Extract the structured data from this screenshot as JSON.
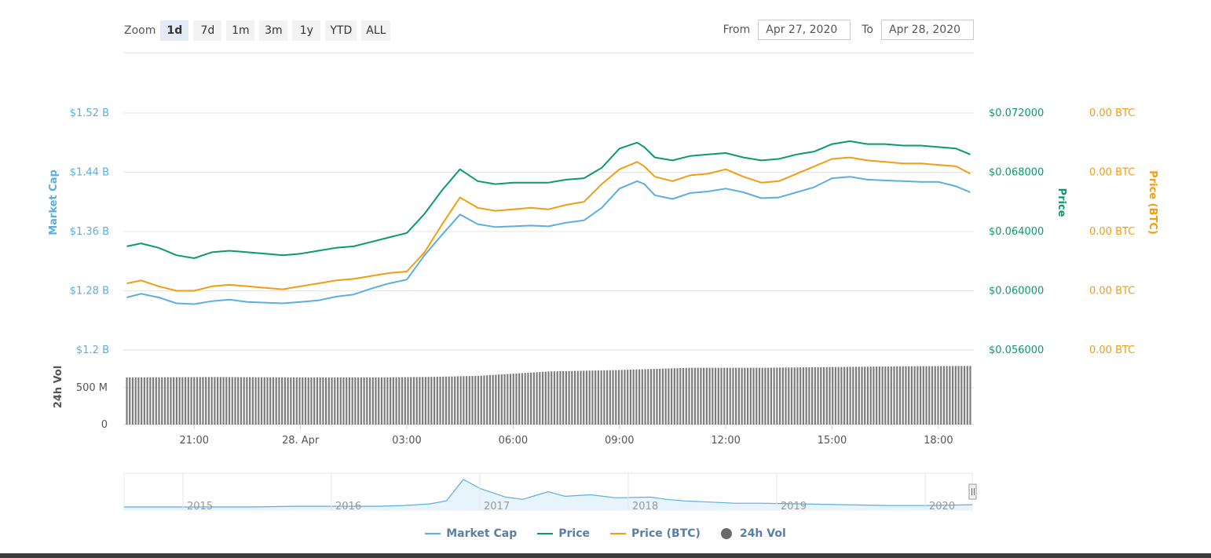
{
  "toolbar": {
    "zoom_label": "Zoom",
    "buttons": [
      "1d",
      "7d",
      "1m",
      "3m",
      "1y",
      "YTD",
      "ALL"
    ],
    "active": "1d",
    "from_label": "From",
    "from_value": "Apr 27, 2020",
    "to_label": "To",
    "to_value": "Apr 28, 2020"
  },
  "colors": {
    "market_cap": "#5aaee0",
    "price": "#0b9a6d",
    "price_btc": "#f39c12",
    "volume": "#7c7c7c",
    "market_cap_axis": "#5aaee0",
    "price_axis": "#0b9a6d",
    "price_btc_axis": "#f39c12"
  },
  "chart_data": {
    "type": "line",
    "x_ticks": [
      "21:00",
      "28. Apr",
      "03:00",
      "06:00",
      "09:00",
      "12:00",
      "15:00",
      "18:00"
    ],
    "x_tick_hours": [
      21,
      24,
      27,
      30,
      33,
      36,
      39,
      42
    ],
    "x_range_hours": [
      19.0,
      43.0
    ],
    "axes": {
      "market_cap": {
        "label": "Market Cap",
        "ticks": [
          "$1.52 B",
          "$1.44 B",
          "$1.36 B",
          "$1.28 B",
          "$1.2 B"
        ],
        "ylim": [
          1.2,
          1.52
        ]
      },
      "price": {
        "label": "Price",
        "ticks": [
          "$0.072000",
          "$0.068000",
          "$0.064000",
          "$0.060000",
          "$0.056000"
        ],
        "ylim": [
          0.056,
          0.072
        ]
      },
      "price_btc": {
        "label": "Price (BTC)",
        "ticks": [
          "0.00 BTC",
          "0.00 BTC",
          "0.00 BTC",
          "0.00 BTC",
          "0.00 BTC"
        ]
      },
      "volume": {
        "label": "24h Vol",
        "ticks": [
          "500 M",
          "0"
        ],
        "ylim": [
          0,
          1000
        ]
      }
    },
    "series": [
      {
        "name": "Market Cap",
        "key": "market_cap",
        "x": [
          19.1,
          19.5,
          20.0,
          20.5,
          21.0,
          21.5,
          22.0,
          22.5,
          23.0,
          23.5,
          24.0,
          24.5,
          25.0,
          25.5,
          26.0,
          26.5,
          27.0,
          27.5,
          28.0,
          28.5,
          29.0,
          29.5,
          30.0,
          30.5,
          31.0,
          31.5,
          32.0,
          32.5,
          33.0,
          33.5,
          33.7,
          34.0,
          34.5,
          35.0,
          35.5,
          36.0,
          36.5,
          37.0,
          37.5,
          38.0,
          38.5,
          39.0,
          39.5,
          40.0,
          40.5,
          41.0,
          41.5,
          42.0,
          42.5,
          42.9
        ],
        "y": [
          1.271,
          1.276,
          1.271,
          1.263,
          1.262,
          1.266,
          1.268,
          1.265,
          1.264,
          1.263,
          1.265,
          1.267,
          1.272,
          1.275,
          1.283,
          1.29,
          1.295,
          1.328,
          1.356,
          1.383,
          1.37,
          1.366,
          1.367,
          1.368,
          1.367,
          1.372,
          1.375,
          1.392,
          1.418,
          1.428,
          1.424,
          1.409,
          1.404,
          1.412,
          1.414,
          1.418,
          1.413,
          1.405,
          1.406,
          1.413,
          1.42,
          1.432,
          1.434,
          1.43,
          1.429,
          1.428,
          1.427,
          1.427,
          1.421,
          1.413
        ]
      },
      {
        "name": "Price",
        "key": "price",
        "x": [
          19.1,
          19.5,
          20.0,
          20.5,
          21.0,
          21.5,
          22.0,
          22.5,
          23.0,
          23.5,
          24.0,
          24.5,
          25.0,
          25.5,
          26.0,
          26.5,
          27.0,
          27.5,
          28.0,
          28.5,
          29.0,
          29.5,
          30.0,
          30.5,
          31.0,
          31.5,
          32.0,
          32.5,
          33.0,
          33.5,
          33.7,
          34.0,
          34.5,
          35.0,
          35.5,
          36.0,
          36.5,
          37.0,
          37.5,
          38.0,
          38.5,
          39.0,
          39.5,
          40.0,
          40.5,
          41.0,
          41.5,
          42.0,
          42.5,
          42.9
        ],
        "y": [
          0.063,
          0.0632,
          0.0629,
          0.0624,
          0.0622,
          0.0626,
          0.0627,
          0.0626,
          0.0625,
          0.0624,
          0.0625,
          0.0627,
          0.0629,
          0.063,
          0.0633,
          0.0636,
          0.0639,
          0.0652,
          0.0668,
          0.0682,
          0.0674,
          0.0672,
          0.0673,
          0.0673,
          0.0673,
          0.0675,
          0.0676,
          0.0683,
          0.0696,
          0.07,
          0.0697,
          0.069,
          0.0688,
          0.0691,
          0.0692,
          0.0693,
          0.069,
          0.0688,
          0.0689,
          0.0692,
          0.0694,
          0.0699,
          0.0701,
          0.0699,
          0.0699,
          0.0698,
          0.0698,
          0.0697,
          0.0696,
          0.0692
        ]
      },
      {
        "name": "Price (BTC)",
        "key": "price_btc",
        "y_on": "price",
        "x": [
          19.1,
          19.5,
          20.0,
          20.5,
          21.0,
          21.5,
          22.0,
          22.5,
          23.0,
          23.5,
          24.0,
          24.5,
          25.0,
          25.5,
          26.0,
          26.5,
          27.0,
          27.5,
          28.0,
          28.5,
          29.0,
          29.5,
          30.0,
          30.5,
          31.0,
          31.5,
          32.0,
          32.5,
          33.0,
          33.5,
          33.7,
          34.0,
          34.5,
          35.0,
          35.5,
          36.0,
          36.5,
          37.0,
          37.5,
          38.0,
          38.5,
          39.0,
          39.5,
          40.0,
          40.5,
          41.0,
          41.5,
          42.0,
          42.5,
          42.9
        ],
        "y": [
          0.0605,
          0.0607,
          0.0603,
          0.06,
          0.06,
          0.0603,
          0.0604,
          0.0603,
          0.0602,
          0.0601,
          0.0603,
          0.0605,
          0.0607,
          0.0608,
          0.061,
          0.0612,
          0.0613,
          0.0626,
          0.0645,
          0.0663,
          0.0656,
          0.0654,
          0.0655,
          0.0656,
          0.0655,
          0.0658,
          0.066,
          0.0672,
          0.0682,
          0.0687,
          0.0684,
          0.0677,
          0.0674,
          0.0678,
          0.0679,
          0.0682,
          0.0677,
          0.0673,
          0.0674,
          0.0679,
          0.0684,
          0.0689,
          0.069,
          0.0688,
          0.0687,
          0.0686,
          0.0686,
          0.0685,
          0.0684,
          0.0679
        ]
      },
      {
        "name": "24h Vol",
        "key": "volume",
        "type": "bar",
        "x": [
          19.1,
          21.5,
          24.0,
          26.0,
          27.5,
          29.0,
          31.0,
          33.0,
          35.0,
          37.0,
          39.0,
          41.0,
          42.9
        ],
        "y": [
          640,
          645,
          640,
          640,
          645,
          660,
          720,
          740,
          770,
          770,
          780,
          790,
          795
        ]
      }
    ],
    "navigator": {
      "labels": [
        "2015",
        "2016",
        "2017",
        "2018",
        "2019",
        "2020"
      ],
      "x": [
        0,
        5,
        10,
        15,
        20,
        25,
        30,
        33,
        36,
        38,
        40,
        42,
        45,
        47,
        50,
        52,
        55,
        58,
        62,
        64,
        66,
        68,
        70,
        72,
        75,
        80,
        85,
        90,
        95,
        100
      ],
      "y": [
        2,
        2,
        2,
        2,
        3,
        3,
        3,
        4,
        6,
        10,
        38,
        26,
        15,
        12,
        22,
        16,
        18,
        14,
        15,
        12,
        10,
        9,
        8,
        7,
        7,
        6,
        5,
        4,
        4,
        5
      ]
    }
  },
  "legend": [
    {
      "label": "Market Cap",
      "key": "market_cap"
    },
    {
      "label": "Price",
      "key": "price"
    },
    {
      "label": "Price (BTC)",
      "key": "price_btc"
    },
    {
      "label": "24h Vol",
      "key": "volume"
    }
  ]
}
